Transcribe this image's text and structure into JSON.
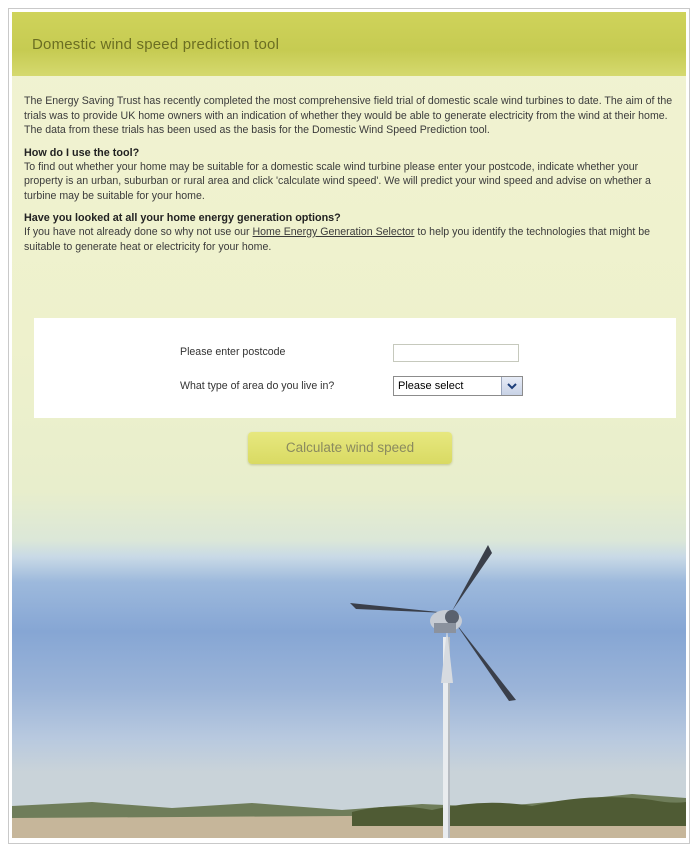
{
  "header": {
    "title": "Domestic wind speed prediction tool"
  },
  "intro": {
    "text": "The Energy Saving Trust has recently completed the most comprehensive field trial of domestic scale wind turbines to date. The aim of the trials was to provide UK home owners with an indication of whether they would be able to generate electricity from the wind at their home. The data from these trials has been used as the basis for the Domestic Wind Speed Prediction tool."
  },
  "how_to": {
    "heading": "How do I use the tool?",
    "text": "To find out whether your home may be suitable for a domestic scale wind turbine please enter your postcode, indicate whether your property is an urban, suburban or rural area and click 'calculate wind speed'. We will predict your wind speed and advise on whether a turbine may be suitable for your home."
  },
  "options": {
    "heading": "Have you looked at all your home energy generation options?",
    "text_before": "If you have not already done so why not use our ",
    "link_text": "Home Energy Generation Selector",
    "text_after": " to help you identify the technologies that might be suitable to generate heat or electricity for your home."
  },
  "form": {
    "postcode_label": "Please enter postcode",
    "postcode_value": "",
    "area_label": "What type of area do you live in?",
    "area_selected": "Please select"
  },
  "actions": {
    "calculate_label": "Calculate wind speed"
  },
  "icons": {
    "select_arrow": "chevron-down-icon",
    "illustration": "wind-turbine-illustration"
  },
  "colors": {
    "header": "#cfd35a",
    "title_text": "#6b6e22",
    "button": "#dcdd68",
    "sky": "#86a6d4"
  }
}
